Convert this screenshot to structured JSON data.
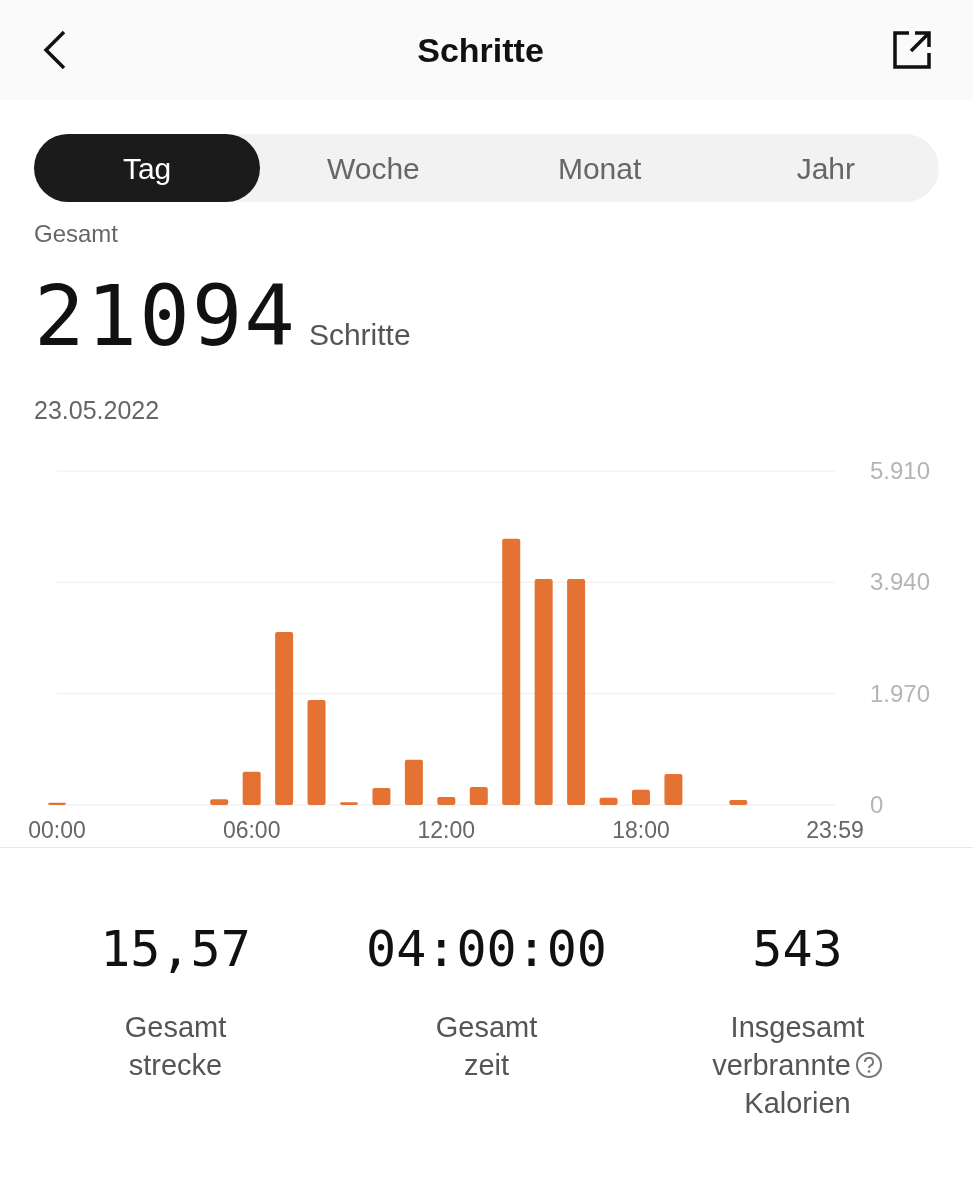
{
  "header": {
    "title": "Schritte"
  },
  "tabs": [
    {
      "label": "Tag",
      "selected": true
    },
    {
      "label": "Woche",
      "selected": false
    },
    {
      "label": "Monat",
      "selected": false
    },
    {
      "label": "Jahr",
      "selected": false
    }
  ],
  "summary": {
    "label": "Gesamt",
    "value": "21094",
    "unit": "Schritte",
    "date": "23.05.2022"
  },
  "chart_data": {
    "type": "bar",
    "x": [
      0,
      1,
      2,
      3,
      4,
      5,
      6,
      7,
      8,
      9,
      10,
      11,
      12,
      13,
      14,
      15,
      16,
      17,
      18,
      19,
      20,
      21,
      22,
      23
    ],
    "series": [
      {
        "color": "#e37233",
        "values": [
          40,
          0,
          0,
          0,
          0,
          100,
          590,
          3060,
          1860,
          50,
          300,
          800,
          140,
          320,
          4710,
          4000,
          4000,
          130,
          270,
          550,
          0,
          90,
          0,
          0
        ]
      }
    ],
    "xticks": [
      {
        "value": 0,
        "label": "00:00"
      },
      {
        "value": 6,
        "label": "06:00"
      },
      {
        "value": 12,
        "label": "12:00"
      },
      {
        "value": 18,
        "label": "18:00"
      },
      {
        "value": 23.98,
        "label": "23:59"
      }
    ],
    "xlim": [
      0,
      23.98
    ],
    "yticks": [
      {
        "value": 5910,
        "label": "5.910"
      },
      {
        "value": 3940,
        "label": "3.940"
      },
      {
        "value": 1970,
        "label": "1.970"
      },
      {
        "value": 0,
        "label": "0"
      }
    ],
    "ylim": [
      0,
      5910
    ]
  },
  "stats": [
    {
      "value": "15,57",
      "label_lines": [
        "Gesamt",
        "strecke"
      ],
      "info": false
    },
    {
      "value": "04:00:00",
      "label_lines": [
        "Gesamt",
        "zeit"
      ],
      "info": false
    },
    {
      "value": "543",
      "label_lines": [
        "Insgesamt",
        "verbrannte",
        "Kalorien"
      ],
      "info": true
    }
  ]
}
